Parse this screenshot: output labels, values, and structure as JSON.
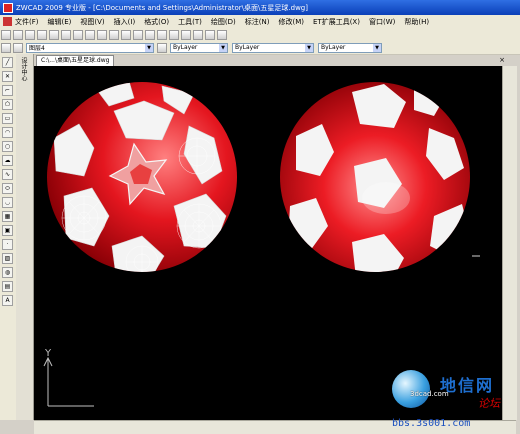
{
  "window": {
    "title": "ZWCAD 2009 专业版 - [C:\\Documents and Settings\\Administrator\\桌面\\五星足球.dwg]"
  },
  "menu": [
    {
      "label": "文件(F)"
    },
    {
      "label": "编辑(E)"
    },
    {
      "label": "视图(V)"
    },
    {
      "label": "插入(I)"
    },
    {
      "label": "格式(O)"
    },
    {
      "label": "工具(T)"
    },
    {
      "label": "绘图(D)"
    },
    {
      "label": "标注(N)"
    },
    {
      "label": "修改(M)"
    },
    {
      "label": "ET扩展工具(X)"
    },
    {
      "label": "窗口(W)"
    },
    {
      "label": "帮助(H)"
    }
  ],
  "layer_toolbar": {
    "layer": "图层4",
    "color": "ByLayer",
    "linetype": "ByLayer",
    "lineweight": "ByLayer"
  },
  "left_panel": {
    "label": "设计中心"
  },
  "document": {
    "tab": "C:\\...\\桌面\\五星足球.dwg",
    "close_glyph": "×"
  },
  "viewport": {
    "background": "#000000",
    "ball_red": "#e4161f",
    "ball_white": "#f4f4f4",
    "ucs_y_label": "Y"
  },
  "watermark": {
    "site": "3dcad.com",
    "cn_title": "地信网",
    "forum": "论坛",
    "bbs": "bbs.3s001.com"
  }
}
